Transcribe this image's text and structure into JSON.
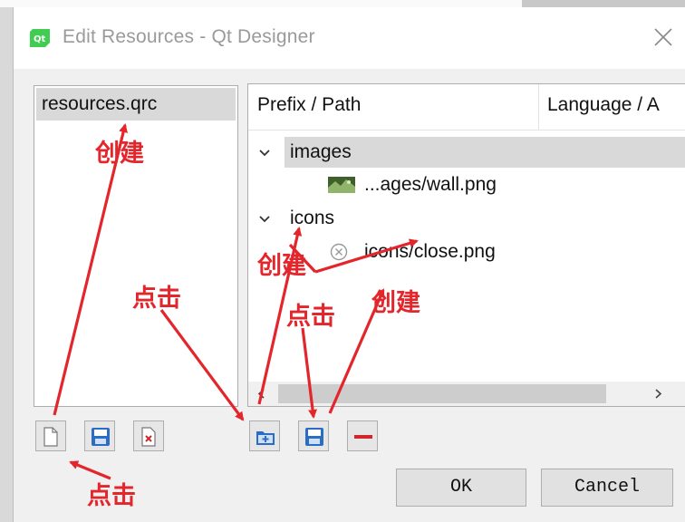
{
  "window": {
    "title": "Edit Resources - Qt Designer",
    "logo_text": "Qt"
  },
  "resource_files": {
    "items": [
      {
        "label": "resources.qrc",
        "selected": true
      }
    ]
  },
  "tree": {
    "headers": [
      "Prefix / Path",
      "Language / A"
    ],
    "rows": [
      {
        "label": "images",
        "type": "prefix",
        "expanded": true,
        "selected": true
      },
      {
        "label": "...ages/wall.png",
        "type": "file",
        "icon": "image-thumbnail-icon"
      },
      {
        "label": "icons",
        "type": "prefix",
        "expanded": true
      },
      {
        "label": "icons/close.png",
        "type": "file",
        "icon": "close-circle-icon"
      }
    ]
  },
  "toolbar_left": [
    {
      "name": "new-resource-file-button",
      "icon": "new-file-icon"
    },
    {
      "name": "open-resource-file-button",
      "icon": "save-disk-icon"
    },
    {
      "name": "remove-resource-file-button",
      "icon": "remove-file-icon"
    }
  ],
  "toolbar_right": [
    {
      "name": "add-prefix-button",
      "icon": "add-folder-icon"
    },
    {
      "name": "add-files-button",
      "icon": "save-disk-icon"
    },
    {
      "name": "remove-button",
      "icon": "minus-icon"
    }
  ],
  "buttons": {
    "ok": "OK",
    "cancel": "Cancel"
  },
  "annotations": {
    "create_1": "创建",
    "click_1": "点击",
    "create_2": "创建",
    "click_2": "点击",
    "create_3": "创建",
    "click_3": "点击"
  },
  "colors": {
    "annotation": "#e3262c",
    "qt_green": "#41cd52",
    "icon_blue": "#2b6cc4"
  }
}
